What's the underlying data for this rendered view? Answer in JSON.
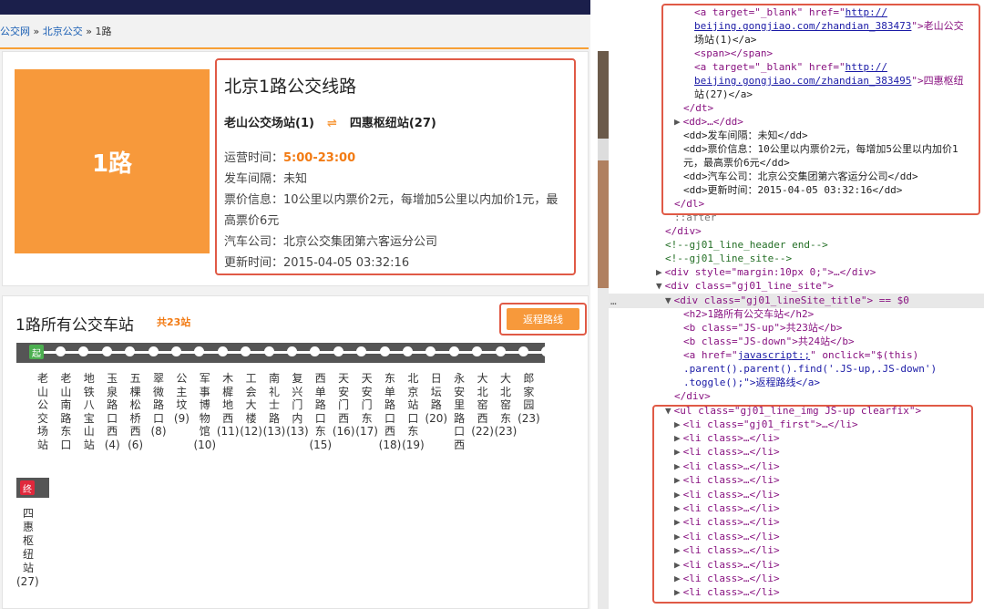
{
  "breadcrumb": {
    "site": "公交网",
    "sep1": "»",
    "city": "北京公交",
    "sep2": "»",
    "current": "1路"
  },
  "line": {
    "logo_text": "1路",
    "title": "北京1路公交线路",
    "from": "老山公交场站(1)",
    "to": "四惠枢纽站(27)",
    "op_time_label": "运营时间：",
    "op_time": "5:00-23:00",
    "interval_label": "发车间隔：",
    "interval": "未知",
    "fare_label": "票价信息：",
    "fare_line1": "10公里以内票价2元，每增加5公里以内加价1元，最",
    "fare_line2": "高票价6元",
    "company_label": "汽车公司：",
    "company": "北京公交集团第六客运分公司",
    "updated_label": "更新时间：",
    "updated": "2015-04-05 03:32:16"
  },
  "stations": {
    "title": "1路所有公交车站",
    "count": "共23站",
    "return_button": "返程路线",
    "start_badge": "起",
    "end_badge": "终",
    "list": [
      {
        "name": "老山公交场站",
        "num": ""
      },
      {
        "name": "老山南路东口",
        "num": ""
      },
      {
        "name": "地铁八宝山站",
        "num": ""
      },
      {
        "name": "玉泉路口西",
        "num": "(4)"
      },
      {
        "name": "五棵松桥西",
        "num": "(6)"
      },
      {
        "name": "翠微路口",
        "num": "(8)"
      },
      {
        "name": "公主坟",
        "num": "(9)"
      },
      {
        "name": "军事博物馆",
        "num": "(10)"
      },
      {
        "name": "木樨地西",
        "num": "(11)"
      },
      {
        "name": "工会大楼",
        "num": "(12)"
      },
      {
        "name": "南礼士路",
        "num": "(13)"
      },
      {
        "name": "复兴门内",
        "num": "(13)"
      },
      {
        "name": "西单路口东",
        "num": "(15)"
      },
      {
        "name": "天安门西",
        "num": "(16)"
      },
      {
        "name": "天安门东",
        "num": "(17)"
      },
      {
        "name": "东单路口西",
        "num": "(18)"
      },
      {
        "name": "北京站口东",
        "num": "(19)"
      },
      {
        "name": "日坛路",
        "num": "(20)"
      },
      {
        "name": "永安里路口西",
        "num": ""
      },
      {
        "name": "大北窑西",
        "num": "(22)"
      },
      {
        "name": "大北窑东",
        "num": "(23)"
      },
      {
        "name": "郎家园",
        "num": "(23)"
      }
    ],
    "end": {
      "name": "四惠枢纽站",
      "num": "(27)"
    }
  },
  "devtools": {
    "l1_open": "<a target=\"_blank\" href=\"",
    "l1_href1": "http://",
    "l1_href2": "beijing.gongjiao.com/zhandian_383473",
    "l1_tail": "\">老山公交",
    "l1_text2": "场站(1)</a>",
    "span": "<span></span>",
    "l2_open": "<a target=\"_blank\" href=\"",
    "l2_href1": "http://",
    "l2_href2": "beijing.gongjiao.com/zhandian_383495",
    "l2_tail": "\">四惠枢纽",
    "l2_text2": "站(27)</a>",
    "dt_close": "</dt>",
    "dd_collapsed": "<dd>…</dd>",
    "dd_interval": "<dd>发车间隔：未知</dd>",
    "dd_fare1": "<dd>票价信息：10公里以内票价2元，每增加5公里以内加价1",
    "dd_fare2": "元，最高票价6元</dd>",
    "dd_company": "<dd>汽车公司：北京公交集团第六客运分公司</dd>",
    "dd_updated": "<dd>更新时间：2015-04-05 03:32:16</dd>",
    "dl_close": "</dl>",
    "after": "::after",
    "div_close": "</div>",
    "cmt_header_end": "<!--gj01_line_header  end-->",
    "cmt_site": "<!--gj01_line_site-->",
    "div_margin": "<div style=\"margin:10px 0;\">…</div>",
    "div_site": "<div class=\"gj01_line_site\">",
    "div_sitetitle": "<div class=\"gj01_lineSite_title\"> == $0",
    "h2": "<h2>1路所有公交车站</h2>",
    "b_up": "<b class=\"JS-up\">共23站</b>",
    "b_down": "<b class=\"JS-down\">共24站</b>",
    "a_js1": "<a href=\"",
    "a_js_href": "javascript:;",
    "a_js2": "\" onclick=\"$(this)",
    "a_js3": ".parent().parent().find('.JS-up,.JS-down')",
    "a_js4": ".toggle();\">返程路线</a>",
    "div_close2": "</div>",
    "ul_open": "<ul class=\"gj01_line_img JS-up clearfix\">",
    "li_first": "<li class=\"gj01_first\">…</li>",
    "li_item": "<li class>…</li>",
    "ellipsis": "…"
  },
  "colors": {
    "accent": "#f7993b",
    "highlight_box": "#e05a46",
    "start": "#4caf50",
    "end": "#e0283c"
  }
}
